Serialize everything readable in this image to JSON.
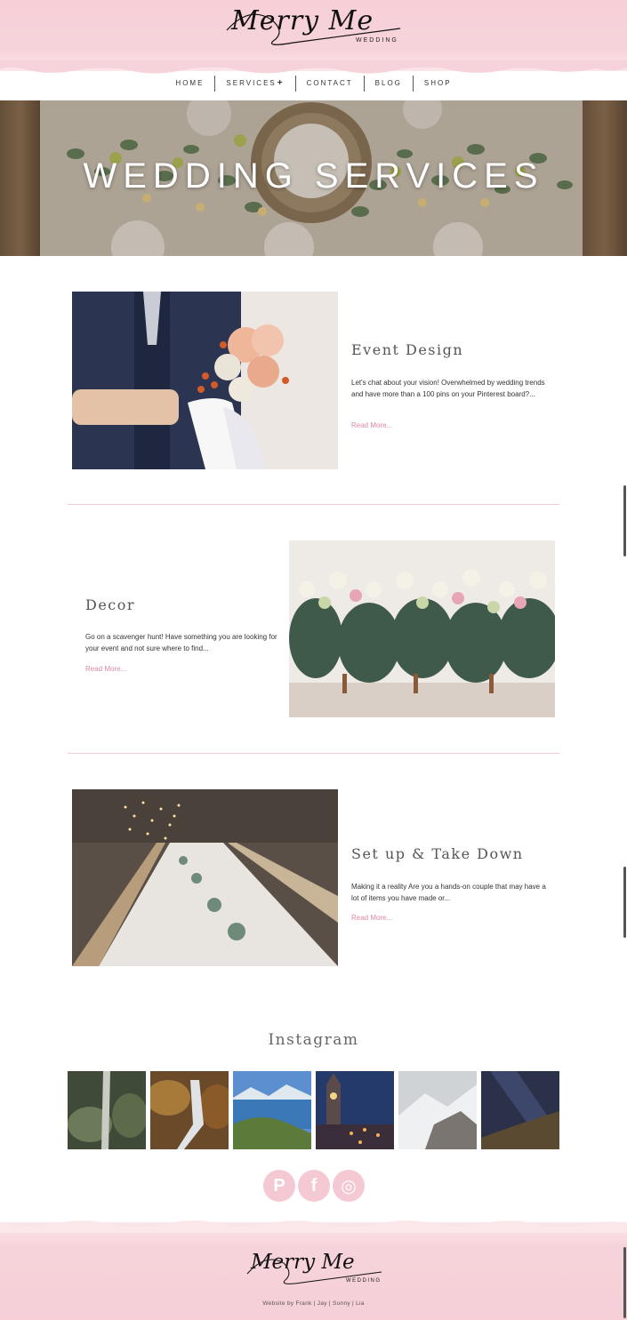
{
  "brand": {
    "logo_script": "Merry Me",
    "logo_sub": "WEDDING",
    "pink": "#f6d3da",
    "accent": "#d98aa0"
  },
  "nav": {
    "items": [
      {
        "label": "HOME"
      },
      {
        "label": "SERVICES",
        "suffix": "+"
      },
      {
        "label": "CONTACT"
      },
      {
        "label": "BLOG"
      },
      {
        "label": "SHOP"
      }
    ]
  },
  "hero": {
    "title": "WEDDING SERVICES"
  },
  "services": [
    {
      "title": "Event Design",
      "text": "Let's chat about your vision! Overwhelmed by wedding trends and have more than a 100 pins on your Pinterest board?...",
      "link": "Read More..."
    },
    {
      "title": "Decor",
      "text": "Go on a scavenger hunt!   Have something you are looking for your event and not sure where to find...",
      "link": "Read More..."
    },
    {
      "title": "Set up & Take Down",
      "text": "Making it a reality Are you a hands-on couple that may have a lot of items you have made or...",
      "link": "Read More..."
    }
  ],
  "instagram": {
    "title": "Instagram",
    "thumbs": [
      "waterfall-moss",
      "waterfall-autumn",
      "lake-mountains",
      "clock-tower-night",
      "snowy-mountain",
      "milky-way"
    ]
  },
  "social": [
    {
      "icon": "pinterest-icon",
      "glyph": "P"
    },
    {
      "icon": "facebook-icon",
      "glyph": "f"
    },
    {
      "icon": "instagram-icon",
      "glyph": "◎"
    }
  ],
  "footer": {
    "logo_script": "Merry Me",
    "logo_sub": "WEDDING",
    "credit": "Website by Frank | Jay | Sunny | Lia"
  }
}
